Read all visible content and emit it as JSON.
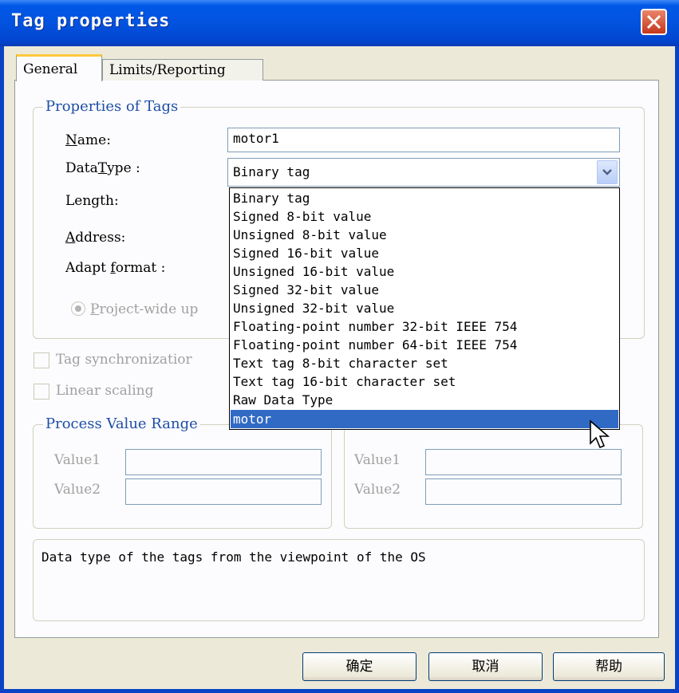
{
  "window": {
    "title": "Tag properties"
  },
  "tabs": [
    {
      "label": "General"
    },
    {
      "label": "Limits/Reporting"
    }
  ],
  "properties_group": {
    "legend": "Properties of Tags",
    "name_label_first": "N",
    "name_label_rest": "ame:",
    "name_value": "motor1",
    "datatype_label_a": "Data",
    "datatype_label_u": "T",
    "datatype_label_b": "ype :",
    "datatype_value": "Binary tag",
    "length_label": "Length:",
    "address_label_first": "A",
    "address_label_rest": "ddress:",
    "adapt_label_a": "Adapt ",
    "adapt_label_u": "f",
    "adapt_label_b": "ormat :",
    "radio_label_u": "P",
    "radio_label_rest": "roject-wide up"
  },
  "dropdown_options": [
    "Binary tag",
    "Signed 8-bit value",
    "Unsigned 8-bit value",
    "Signed 16-bit value",
    "Unsigned 16-bit value",
    "Signed 32-bit value",
    "Unsigned 32-bit value",
    "Floating-point number 32-bit IEEE 754",
    "Floating-point number 64-bit IEEE 754",
    "Text tag 8-bit character set",
    "Text tag 16-bit character set",
    "Raw Data Type",
    "motor"
  ],
  "dropdown_highlighted": "motor",
  "checkboxes": {
    "tag_sync": "Tag synchronizatior",
    "linear_scaling": "Linear scaling"
  },
  "process_range": {
    "legend": "Process Value Range",
    "value1": "Value1",
    "value2": "Value2"
  },
  "tag_range": {
    "value1": "Value1",
    "value2": "Value2"
  },
  "description": "Data type of the tags from the viewpoint of the OS",
  "buttons": {
    "ok": "确定",
    "cancel": "取消",
    "help": "帮助"
  },
  "colors": {
    "titlebar": "#0353df",
    "highlight": "#316ac5",
    "legend": "#1e4ea6"
  }
}
